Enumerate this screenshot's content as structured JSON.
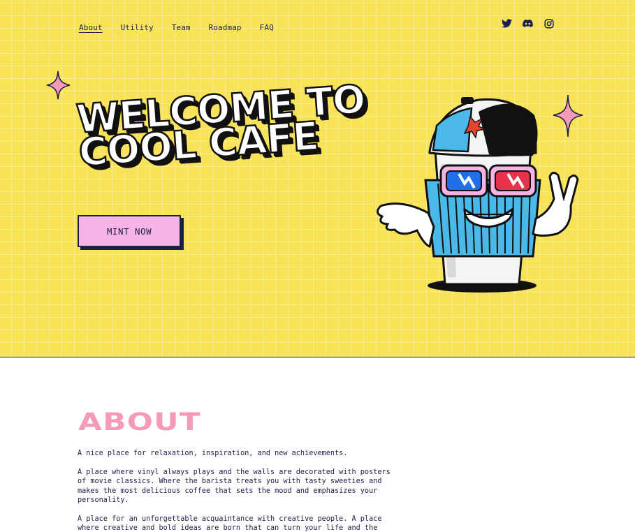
{
  "nav": {
    "items": [
      {
        "label": "About",
        "active": true
      },
      {
        "label": "Utility",
        "active": false
      },
      {
        "label": "Team",
        "active": false
      },
      {
        "label": "Roadmap",
        "active": false
      },
      {
        "label": "FAQ",
        "active": false
      }
    ]
  },
  "socials": [
    "twitter-icon",
    "discord-icon",
    "instagram-icon"
  ],
  "hero": {
    "headline_line1": "WELCOME TO",
    "headline_line2": "COOL CAFE",
    "cta_label": "MINT NOW"
  },
  "about": {
    "title": "ABOUT",
    "paragraphs": [
      "A nice place for relaxation, inspiration, and new achievements.",
      "A place where vinyl always plays and the walls are decorated with posters of movie classics. Where the barista treats you with tasty sweeties and makes the most delicious coffee that sets the mood and emphasizes your personality.",
      "A place for an unforgettable acquaintance with creative people. A place where creative and bold ideas are born that can turn your life and the"
    ]
  },
  "colors": {
    "hero_bg": "#f8e257",
    "accent_pink": "#f7b3e6",
    "title_pink": "#f59ab8",
    "navy": "#1d1f4a"
  }
}
